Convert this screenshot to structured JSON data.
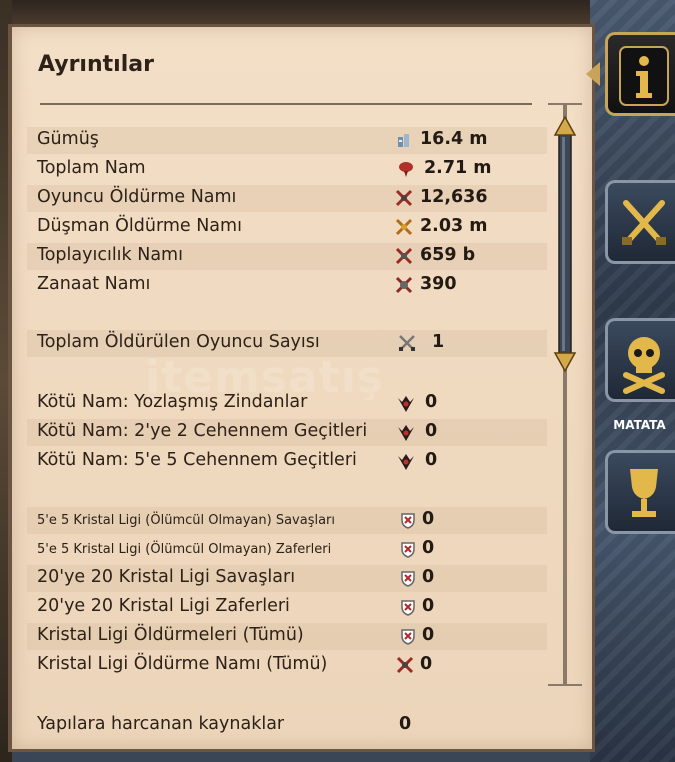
{
  "panel": {
    "title": "Ayrıntılar"
  },
  "stats_group1": [
    {
      "label": "Gümüş",
      "value": "16.4 m",
      "icon": "silver-icon"
    },
    {
      "label": "Toplam Nam",
      "value": "2.71 m",
      "icon": "fame-icon"
    },
    {
      "label": "Oyuncu Öldürme Namı",
      "value": "12,636",
      "icon": "pvp-fame-icon"
    },
    {
      "label": "Düşman Öldürme Namı",
      "value": "2.03 m",
      "icon": "pve-fame-icon"
    },
    {
      "label": "Toplayıcılık Namı",
      "value": "659 b",
      "icon": "gathering-fame-icon"
    },
    {
      "label": "Zanaat Namı",
      "value": "390",
      "icon": "crafting-fame-icon"
    }
  ],
  "stats_group2": [
    {
      "label": "Toplam Öldürülen Oyuncu Sayısı",
      "value": "1",
      "icon": "crossed-swords-icon"
    }
  ],
  "stats_group3": [
    {
      "label": "Kötü Nam: Yozlaşmış Zindanlar",
      "value": "0",
      "icon": "infamy-icon"
    },
    {
      "label": "Kötü Nam: 2'ye 2 Cehennem Geçitleri",
      "value": "0",
      "icon": "infamy-icon"
    },
    {
      "label": "Kötü Nam: 5'e 5 Cehennem Geçitleri",
      "value": "0",
      "icon": "infamy-icon"
    }
  ],
  "stats_group4": [
    {
      "label": "5'e 5 Kristal Ligi (Ölümcül Olmayan) Savaşları",
      "value": "0",
      "icon": "crystal-shield-icon"
    },
    {
      "label": "5'e 5 Kristal Ligi (Ölümcül Olmayan) Zaferleri",
      "value": "0",
      "icon": "crystal-shield-icon"
    },
    {
      "label": "20'ye 20 Kristal Ligi Savaşları",
      "value": "0",
      "icon": "crystal-shield-icon"
    },
    {
      "label": "20'ye 20 Kristal Ligi Zaferleri",
      "value": "0",
      "icon": "crystal-shield-icon"
    },
    {
      "label": "Kristal Ligi Öldürmeleri (Tümü)",
      "value": "0",
      "icon": "crystal-shield-icon"
    },
    {
      "label": "Kristal Ligi Öldürme Namı (Tümü)",
      "value": "0",
      "icon": "pvp-fame-icon"
    }
  ],
  "stats_group5": [
    {
      "label": "Yapılara harcanan kaynaklar",
      "value": "0"
    }
  ],
  "side_tabs": [
    {
      "name": "info",
      "icon": "info-icon",
      "active": true
    },
    {
      "name": "combat",
      "icon": "crossed-swords-icon"
    },
    {
      "name": "pvp",
      "icon": "skull-crossbones-icon"
    },
    {
      "name": "achievements",
      "icon": "goblet-icon"
    }
  ],
  "player_tag": {
    "name": "MATATA"
  },
  "watermark": "itemsatış",
  "colors": {
    "parchment": "#efd9bf",
    "text": "#2d2118",
    "accent_gold": "#c8a45a",
    "stone": "#3a4656"
  }
}
